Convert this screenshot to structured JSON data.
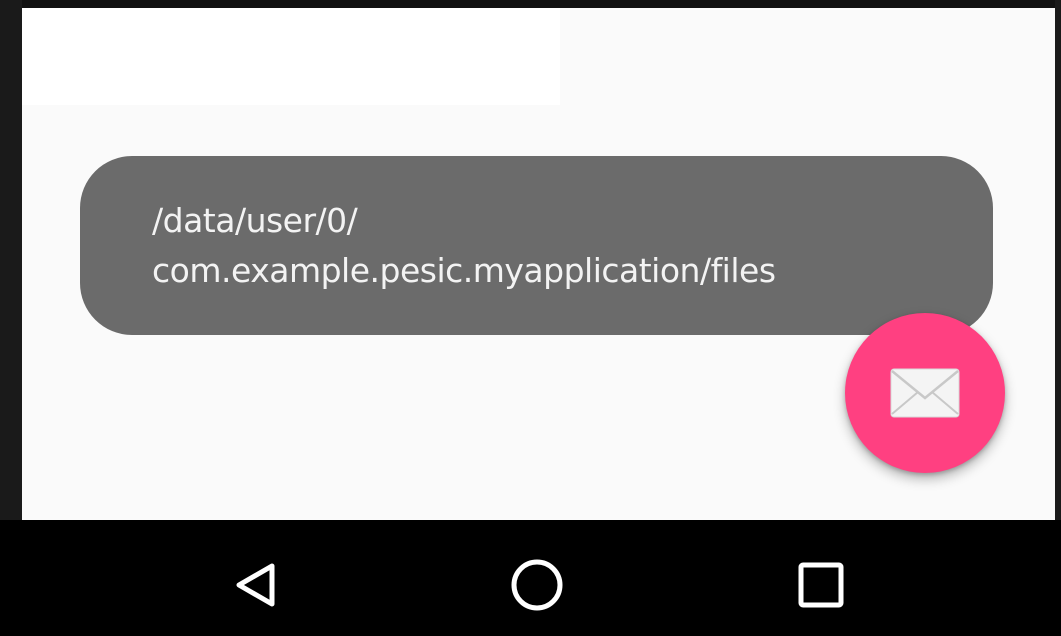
{
  "toast": {
    "line1": "/data/user/0/",
    "line2": "com.example.pesic.myapplication/files"
  },
  "fab": {
    "icon": "envelope-icon",
    "color": "#ff4081"
  },
  "navbar": {
    "back_icon": "back-triangle-icon",
    "home_icon": "home-circle-icon",
    "recents_icon": "recents-square-icon"
  }
}
